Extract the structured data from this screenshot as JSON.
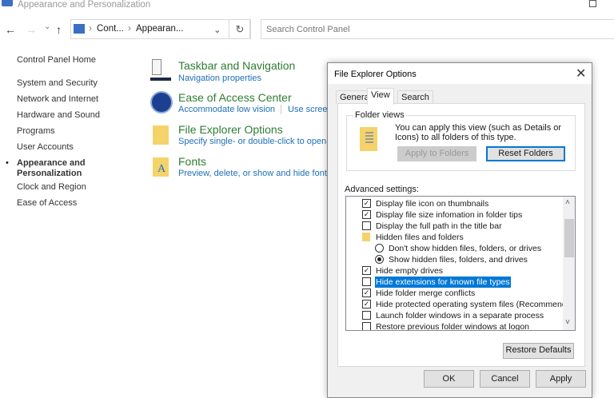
{
  "window": {
    "title": "Appearance and Personalization"
  },
  "toolbar": {
    "back": "←",
    "forward": "→",
    "recent": "⌄",
    "up": "↑",
    "breadcrumb": [
      "Cont...",
      "Appearan..."
    ],
    "sep": "›",
    "dropdown": "⌄",
    "refresh": "↻",
    "search_placeholder": "Search Control Panel"
  },
  "sidebar": {
    "home": "Control Panel Home",
    "items": [
      {
        "label": "System and Security"
      },
      {
        "label": "Network and Internet"
      },
      {
        "label": "Hardware and Sound"
      },
      {
        "label": "Programs"
      },
      {
        "label": "User Accounts"
      },
      {
        "label": "Appearance and Personalization",
        "active": true
      },
      {
        "label": "Clock and Region"
      },
      {
        "label": "Ease of Access"
      }
    ]
  },
  "categories": [
    {
      "title": "Taskbar and Navigation",
      "links": [
        "Navigation properties"
      ],
      "icon": "taskbar-icon"
    },
    {
      "title": "Ease of Access Center",
      "links": [
        "Accommodate low vision",
        "Use screen"
      ],
      "icon": "ease-of-access-icon"
    },
    {
      "title": "File Explorer Options",
      "links": [
        "Specify single- or double-click to open"
      ],
      "icon": "folder-options-icon"
    },
    {
      "title": "Fonts",
      "links": [
        "Preview, delete, or show and hide fonts"
      ],
      "icon": "fonts-icon"
    }
  ],
  "dialog": {
    "title": "File Explorer Options",
    "close": "✕",
    "tabs": [
      "General",
      "View",
      "Search"
    ],
    "active_tab": "View",
    "folder_views": {
      "label": "Folder views",
      "text": "You can apply this view (such as Details or Icons) to all folders of this type.",
      "apply": "Apply to Folders",
      "reset": "Reset Folders"
    },
    "advanced_label": "Advanced settings:",
    "settings": [
      {
        "type": "checkbox",
        "label": "Display file icon on thumbnails",
        "checked": true
      },
      {
        "type": "checkbox",
        "label": "Display file size infomation in folder tips",
        "checked": true
      },
      {
        "type": "checkbox",
        "label": "Display the full path in the title bar",
        "checked": false
      },
      {
        "type": "folder",
        "label": "Hidden files and folders"
      },
      {
        "type": "radio",
        "label": "Don't show hidden files, folders, or drives",
        "checked": false
      },
      {
        "type": "radio",
        "label": "Show hidden files, folders, and drives",
        "checked": true
      },
      {
        "type": "checkbox",
        "label": "Hide empty drives",
        "checked": true
      },
      {
        "type": "checkbox",
        "label": "Hide extensions for known file types",
        "checked": false,
        "selected": true
      },
      {
        "type": "checkbox",
        "label": "Hide folder merge conflicts",
        "checked": true
      },
      {
        "type": "checkbox",
        "label": "Hide protected operating system files (Recommended)",
        "checked": true
      },
      {
        "type": "checkbox",
        "label": "Launch folder windows in a separate process",
        "checked": false
      },
      {
        "type": "checkbox",
        "label": "Restore previous folder windows at logon",
        "checked": false
      }
    ],
    "scroll_up": "˄",
    "scroll_down": "˅",
    "restore_defaults": "Restore Defaults",
    "ok": "OK",
    "cancel": "Cancel",
    "apply": "Apply"
  },
  "colors": {
    "category": "#2e7d32",
    "link": "#1e6fb8",
    "selection": "#0078d7"
  }
}
